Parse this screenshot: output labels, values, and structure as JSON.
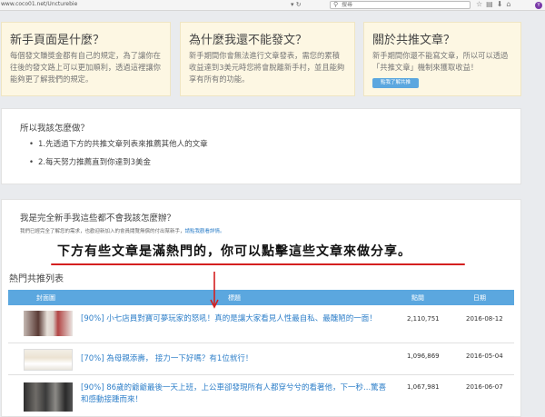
{
  "browser": {
    "url": "www.coco01.net/Uncturebie",
    "search_placeholder": "搜尋",
    "profile_initial": "Y"
  },
  "cards": [
    {
      "title": "新手頁面是什麼？",
      "body": "每個發文賺獎金都有自己的規定，為了讓你在往後的發文路上可以更加順利，透過這裡讓你能夠更了解我們的規定。"
    },
    {
      "title": "為什麼我還不能發文？",
      "body": "新手期間你會無法進行文章發表，需您的累積收益達到3美元時您將會脫離新手村，並且能夠享有所有的功能。"
    },
    {
      "title": "關於共推文章？",
      "body": "新手期間你還不能寫文章，所以可以透過「共推文章」機制來獲取收益！",
      "button": "點我了解共推"
    }
  ],
  "what_to_do": {
    "title": "所以我該怎麼做？",
    "steps": [
      "1.先透過下方的共推文章列表來推薦其他人的文章",
      "2.每天努力推薦直到你達到3美金"
    ]
  },
  "newbie": {
    "title": "我是完全新手我這些都不會我該怎麼辦？",
    "sub": "我們已經完全了解您的需求，也歡迎新加入的會員閱覽無償的付出幫新手，",
    "link": "請點我觀看詳情。"
  },
  "annotation": "下方有些文章是滿熱門的，你可以點擊這些文章來做分享。",
  "hot_list": {
    "title": "熱門共推列表",
    "headers": {
      "cover": "封面圖",
      "title": "標題",
      "clicks": "點閱",
      "date": "日期"
    },
    "rows": [
      {
        "title": "[90%] 小七店員對寶可夢玩家的怒吼！真的是讓大家看見人性最自私、最醜陋的一面！",
        "clicks": "2,110,751",
        "date": "2016-08-12"
      },
      {
        "title": "[70%] 為母親添壽，  接力一下好嗎？有1位就行！",
        "clicks": "1,096,869",
        "date": "2016-05-04"
      },
      {
        "title": "[90%] 86歲的爺爺最後一天上班，上公車卻發現所有人都穿兮兮的看著他，下一秒...驚喜和感動接踵而來！",
        "clicks": "1,067,981",
        "date": "2016-06-07"
      }
    ]
  }
}
